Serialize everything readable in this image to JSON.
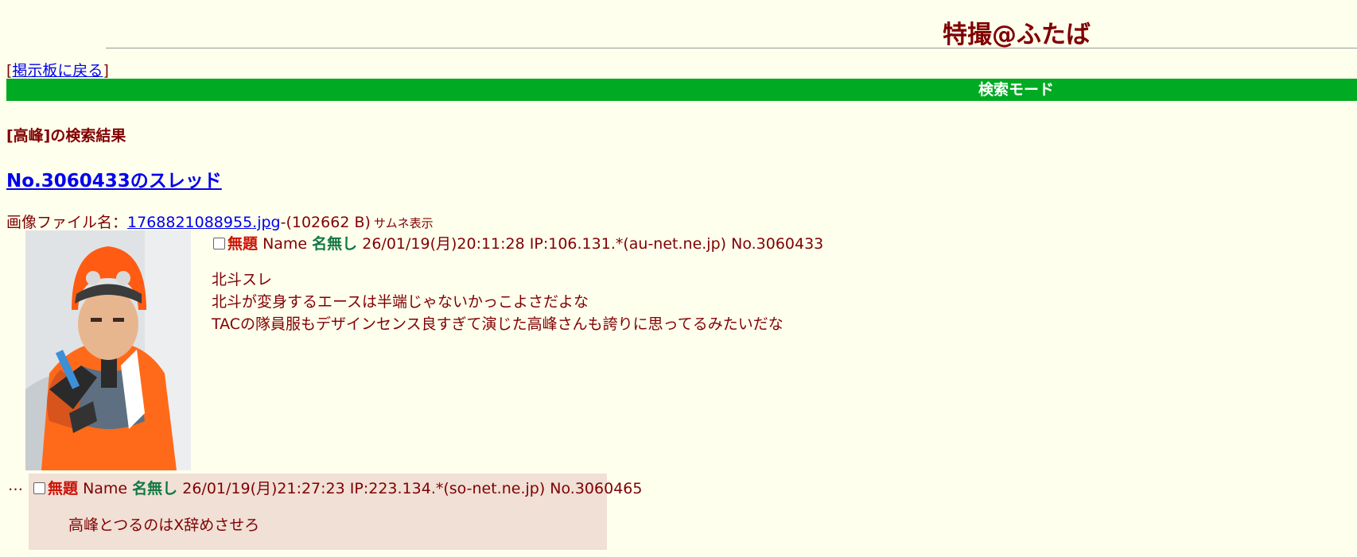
{
  "header": {
    "title": "特撮@ふたば"
  },
  "nav": {
    "bracket_open": "[",
    "back_label": "掲示板に戻る",
    "bracket_close": "]"
  },
  "mode_bar": {
    "label": "検索モード",
    "color": "#00aa22"
  },
  "search": {
    "result_heading": "[高峰]の検索結果"
  },
  "thread": {
    "link_label": "No.3060433のスレッド",
    "file": {
      "prefix": "画像ファイル名：",
      "filename": "1768821088955.jpg",
      "size": "-(102662 B)",
      "thumb_label": "サムネ表示"
    },
    "op": {
      "subject": "無題",
      "name_label": "Name",
      "name": "名無し",
      "datetime": "26/01/19(月)20:11:28",
      "ip": "IP:106.131.*(au-net.ne.jp)",
      "number": "No.3060433",
      "lines": [
        "北斗スレ",
        "北斗が変身するエースは半端じゃないかっこよさだよな",
        "TACの隊員服もデザインセンス良すぎて演じた高峰さんも誇りに思ってるみたいだな"
      ]
    },
    "reply": {
      "ellipsis": "…",
      "subject": "無題",
      "name_label": "Name",
      "name": "名無し",
      "datetime": "26/01/19(月)21:27:23",
      "ip": "IP:223.134.*(so-net.ne.jp)",
      "number": "No.3060465",
      "body": "高峰とつるのはX辞めさせろ"
    }
  },
  "colors": {
    "background": "#ffffee",
    "text": "#800000",
    "subject": "#cc1105",
    "name": "#117743",
    "reply_bg": "#f0e0d6",
    "link": "#0000ee"
  }
}
